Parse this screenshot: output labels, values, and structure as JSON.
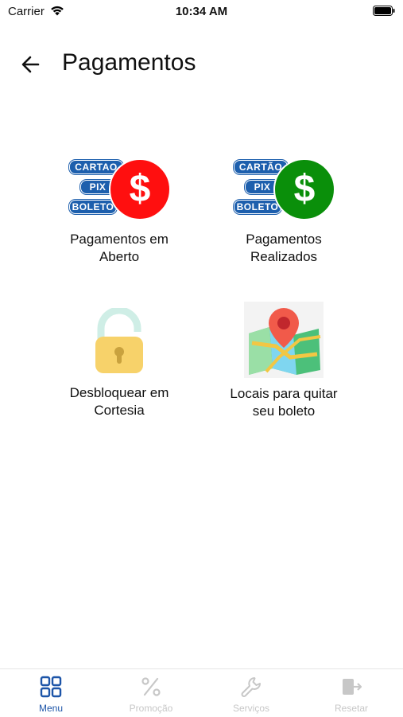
{
  "status_bar": {
    "carrier": "Carrier",
    "time": "10:34 AM"
  },
  "header": {
    "title": "Pagamentos"
  },
  "tiles": [
    {
      "label_line1": "Pagamentos em",
      "label_line2": "Aberto",
      "icon": "payment-open-icon"
    },
    {
      "label_line1": "Pagamentos",
      "label_line2": "Realizados",
      "icon": "payment-done-icon"
    },
    {
      "label_line1": "Desbloquear em",
      "label_line2": "Cortesia",
      "icon": "unlock-padlock-icon"
    },
    {
      "label_line1": "Locais para quitar",
      "label_line2": "seu boleto",
      "icon": "map-pin-icon"
    }
  ],
  "payment_badges": [
    "CARTAO",
    "PIX",
    "BOLETO"
  ],
  "payment_badges_alt": [
    "CARTÃO",
    "PIX",
    "BOLETO"
  ],
  "dollar_symbol": "$",
  "colors": {
    "accent": "#1d55a8",
    "badge_blue": "#1d5fad",
    "dollar_red": "#ff0f0f",
    "dollar_green": "#0a8f0a",
    "nav_inactive": "#c7c7c7"
  },
  "bottom_nav": [
    {
      "label": "Menu",
      "icon": "grid-icon",
      "active": true
    },
    {
      "label": "Promoção",
      "icon": "percent-icon",
      "active": false
    },
    {
      "label": "Serviços",
      "icon": "wrench-icon",
      "active": false
    },
    {
      "label": "Resetar",
      "icon": "exit-icon",
      "active": false
    }
  ]
}
